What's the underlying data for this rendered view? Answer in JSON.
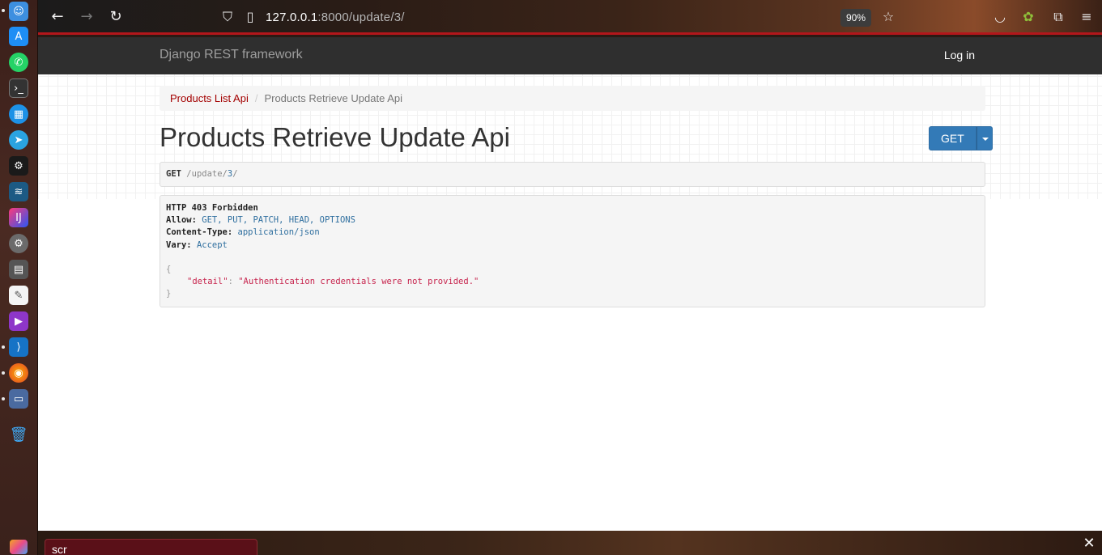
{
  "browser": {
    "url_host": "127.0.0.1",
    "url_rest": ":8000/update/3/",
    "zoom": "90%"
  },
  "drf": {
    "brand": "Django REST framework",
    "login": "Log in",
    "breadcrumb": [
      "Products List Api",
      "Products Retrieve Update Api"
    ],
    "title": "Products Retrieve Update Api",
    "get_button": "GET",
    "request": {
      "method": "GET",
      "path_prefix": "/update/",
      "path_id": "3",
      "path_suffix": "/"
    },
    "response": {
      "status": "HTTP 403 Forbidden",
      "allow_key": "Allow:",
      "allow_val": "GET, PUT, PATCH, HEAD, OPTIONS",
      "ctype_key": "Content-Type:",
      "ctype_val": "application/json",
      "vary_key": "Vary:",
      "vary_val": "Accept",
      "open_brace": "{",
      "detail_key": "\"detail\"",
      "colon": ":",
      "detail_val": "\"Authentication credentials were not provided.\"",
      "close_brace": "}"
    }
  },
  "find_bar": {
    "value": "scr"
  },
  "dock_icons": [
    "finder-icon",
    "app-store-icon",
    "whatsapp-icon",
    "terminal-icon",
    "docker-icon",
    "telegram-icon",
    "steam-icon",
    "mysql-workbench-icon",
    "intellij-icon",
    "settings-icon",
    "calculator-icon",
    "text-editor-icon",
    "video-recorder-icon",
    "vscode-icon",
    "firefox-icon",
    "remote-desktop-icon",
    "trash-icon"
  ]
}
